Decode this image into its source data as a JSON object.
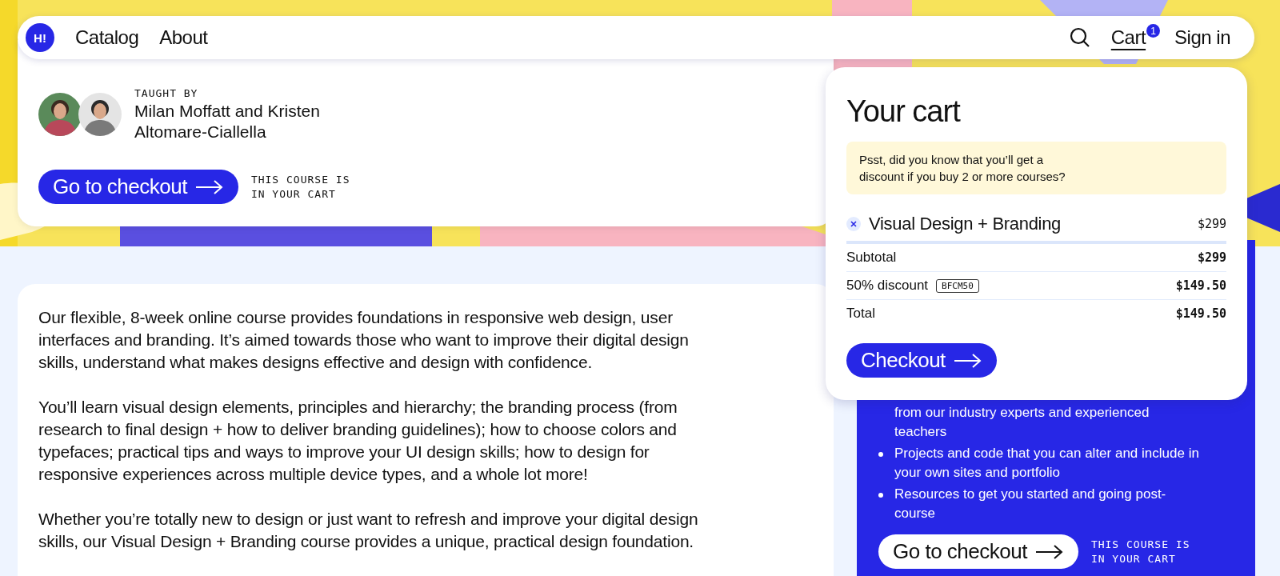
{
  "nav": {
    "logo": "H!",
    "links": [
      {
        "label": "Catalog"
      },
      {
        "label": "About"
      }
    ],
    "cart_link": "Cart",
    "cart_count": "1",
    "sign_in": "Sign in"
  },
  "course": {
    "taught_by_label": "TAUGHT BY",
    "instructors": "Milan Moffatt and Kristen Altomare-Ciallella",
    "checkout_button": "Go to checkout",
    "cart_note": "THIS COURSE IS IN YOUR CART"
  },
  "description": [
    "Our flexible, 8-week online course provides foundations in responsive web design, user interfaces and branding. It’s aimed towards those who want to improve their digital design skills, understand what makes designs effective and design with confidence.",
    "You’ll learn visual design elements, principles and hierarchy; the branding process (from research to final design + how to deliver branding guidelines); how to choose colors and typefaces; practical tips and ways to improve your UI design skills; how to design for responsive experiences across multiple device types, and a whole lot more!",
    "Whether you’re totally new to design or just want to refresh and improve your digital design skills, our Visual Design + Branding course provides a unique, practical design foundation."
  ],
  "features": {
    "items": [
      {
        "text": "from our industry experts and experienced teachers",
        "bullet": false
      },
      {
        "text": "Projects and code that you can alter and include in your own sites and portfolio",
        "bullet": true
      },
      {
        "text": "Resources to get you started and going post-course",
        "bullet": true
      }
    ],
    "checkout_button": "Go to checkout",
    "cart_note": "THIS COURSE IS IN YOUR CART"
  },
  "cart": {
    "title": "Your cart",
    "tip": "Psst, did you know that you’ll get a discount if you buy 2 or more courses?",
    "items": [
      {
        "name": "Visual Design + Branding",
        "price": "$299"
      }
    ],
    "summary": [
      {
        "label": "Subtotal",
        "value": "$299"
      },
      {
        "label": "50% discount",
        "code": "BFCM50",
        "value": "$149.50"
      },
      {
        "label": "Total",
        "value": "$149.50"
      }
    ],
    "checkout_button": "Checkout"
  }
}
